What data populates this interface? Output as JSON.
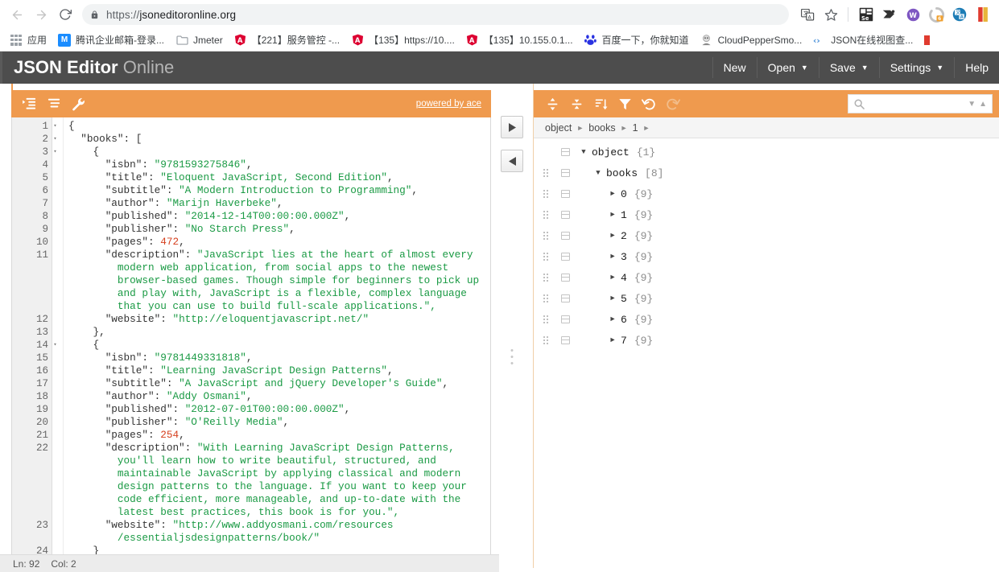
{
  "browser": {
    "back_icon": "back-arrow-icon",
    "forward_icon": "forward-arrow-icon",
    "reload_icon": "reload-icon",
    "lock_icon": "lock-icon",
    "url_scheme": "https://",
    "url_host": "jsoneditoronline.org",
    "url_full": "https://jsoneditoronline.org",
    "omnibar_icons": [
      {
        "name": "translate-icon",
        "glyph": "文A"
      },
      {
        "name": "bookmark-star-icon",
        "glyph": "☆"
      }
    ],
    "extension_icons": [
      {
        "name": "selenium-extension-icon",
        "glyph": "Se",
        "color": "#2b2b2b"
      },
      {
        "name": "wappalyzer-extension-icon",
        "glyph": "◥",
        "color": "#333333"
      },
      {
        "name": "vimium-extension-icon",
        "glyph": "W",
        "color": "#7e57c2"
      },
      {
        "name": "loading-extension-icon",
        "glyph": "◠",
        "color": "#b9b9b9",
        "badge": "6"
      },
      {
        "name": "translate-extension-icon",
        "glyph": "文",
        "color": "#1c7cb5"
      },
      {
        "name": "profile-avatar-icon",
        "glyph": "",
        "color": "#e03b2f"
      }
    ],
    "bookmarks": [
      {
        "name": "apps-grid",
        "label": "应用",
        "icon": "apps-grid-icon",
        "icon_glyph": "",
        "icon_color": "#9aa0a6"
      },
      {
        "name": "tencent-mail",
        "label": "腾讯企业邮箱-登录...",
        "icon": "tencent-mail-icon",
        "icon_glyph": "M",
        "icon_color": "#1a8cff"
      },
      {
        "name": "jmeter",
        "label": "Jmeter",
        "icon": "folder-icon",
        "icon_glyph": "",
        "icon_color": "#9aa0a6"
      },
      {
        "name": "service-control-221",
        "label": "【221】服务管控 -...",
        "icon": "angular-icon",
        "icon_glyph": "A",
        "icon_color": "#dd0031"
      },
      {
        "name": "https-10-135",
        "label": "【135】https://10....",
        "icon": "angular-icon",
        "icon_glyph": "A",
        "icon_color": "#dd0031"
      },
      {
        "name": "ip-10-155",
        "label": "【135】10.155.0.1...",
        "icon": "angular-icon",
        "icon_glyph": "A",
        "icon_color": "#dd0031"
      },
      {
        "name": "baidu",
        "label": "百度一下，你就知道",
        "icon": "baidu-icon",
        "icon_glyph": "熊",
        "icon_color": "#2932e1"
      },
      {
        "name": "cloudpepper",
        "label": "CloudPepperSmo...",
        "icon": "cloudpepper-icon",
        "icon_glyph": "☺",
        "icon_color": "#8a8a8a"
      },
      {
        "name": "json-viewer-cn",
        "label": "JSON在线视图查...",
        "icon": "code-brackets-icon",
        "icon_glyph": "‹›",
        "icon_color": "#4a90d9"
      }
    ]
  },
  "app": {
    "title_bold": "JSON Editor",
    "title_light": "Online",
    "accent_color": "#ef9a4e",
    "header_bg": "#4d4d4d",
    "menu": [
      {
        "name": "new",
        "label": "New",
        "caret": ""
      },
      {
        "name": "open",
        "label": "Open",
        "caret": "▼"
      },
      {
        "name": "save",
        "label": "Save",
        "caret": "▼"
      },
      {
        "name": "settings",
        "label": "Settings",
        "caret": "▼"
      },
      {
        "name": "help",
        "label": "Help",
        "caret": ""
      }
    ]
  },
  "left_pane": {
    "toolbar": {
      "buttons": [
        {
          "name": "format-button",
          "icon": "format-indent-icon"
        },
        {
          "name": "compact-button",
          "icon": "compact-lines-icon"
        },
        {
          "name": "repair-button",
          "icon": "wrench-icon"
        }
      ],
      "powered_by": "powered by ace"
    },
    "code_lines": [
      {
        "no": "1",
        "fold": "▾",
        "text": "{"
      },
      {
        "no": "2",
        "fold": "▾",
        "text": "  \"books\": ["
      },
      {
        "no": "3",
        "fold": "▾",
        "text": "    {"
      },
      {
        "no": "4",
        "fold": "",
        "text": "      \"isbn\": \"9781593275846\","
      },
      {
        "no": "5",
        "fold": "",
        "text": "      \"title\": \"Eloquent JavaScript, Second Edition\","
      },
      {
        "no": "6",
        "fold": "",
        "text": "      \"subtitle\": \"A Modern Introduction to Programming\","
      },
      {
        "no": "7",
        "fold": "",
        "text": "      \"author\": \"Marijn Haverbeke\","
      },
      {
        "no": "8",
        "fold": "",
        "text": "      \"published\": \"2014-12-14T00:00:00.000Z\","
      },
      {
        "no": "9",
        "fold": "",
        "text": "      \"publisher\": \"No Starch Press\","
      },
      {
        "no": "10",
        "fold": "",
        "text": "      \"pages\": 472,"
      },
      {
        "no": "11",
        "fold": "",
        "text": "      \"description\": \"JavaScript lies at the heart of almost every"
      },
      {
        "no": "",
        "fold": "",
        "text": "        modern web application, from social apps to the newest"
      },
      {
        "no": "",
        "fold": "",
        "text": "        browser-based games. Though simple for beginners to pick up"
      },
      {
        "no": "",
        "fold": "",
        "text": "        and play with, JavaScript is a flexible, complex language"
      },
      {
        "no": "",
        "fold": "",
        "text": "        that you can use to build full-scale applications.\","
      },
      {
        "no": "12",
        "fold": "",
        "text": "      \"website\": \"http://eloquentjavascript.net/\""
      },
      {
        "no": "13",
        "fold": "",
        "text": "    },"
      },
      {
        "no": "14",
        "fold": "▾",
        "text": "    {"
      },
      {
        "no": "15",
        "fold": "",
        "text": "      \"isbn\": \"9781449331818\","
      },
      {
        "no": "16",
        "fold": "",
        "text": "      \"title\": \"Learning JavaScript Design Patterns\","
      },
      {
        "no": "17",
        "fold": "",
        "text": "      \"subtitle\": \"A JavaScript and jQuery Developer's Guide\","
      },
      {
        "no": "18",
        "fold": "",
        "text": "      \"author\": \"Addy Osmani\","
      },
      {
        "no": "19",
        "fold": "",
        "text": "      \"published\": \"2012-07-01T00:00:00.000Z\","
      },
      {
        "no": "20",
        "fold": "",
        "text": "      \"publisher\": \"O'Reilly Media\","
      },
      {
        "no": "21",
        "fold": "",
        "text": "      \"pages\": 254,"
      },
      {
        "no": "22",
        "fold": "",
        "text": "      \"description\": \"With Learning JavaScript Design Patterns,"
      },
      {
        "no": "",
        "fold": "",
        "text": "        you'll learn how to write beautiful, structured, and"
      },
      {
        "no": "",
        "fold": "",
        "text": "        maintainable JavaScript by applying classical and modern"
      },
      {
        "no": "",
        "fold": "",
        "text": "        design patterns to the language. If you want to keep your"
      },
      {
        "no": "",
        "fold": "",
        "text": "        code efficient, more manageable, and up-to-date with the"
      },
      {
        "no": "",
        "fold": "",
        "text": "        latest best practices, this book is for you.\","
      },
      {
        "no": "23",
        "fold": "",
        "text": "      \"website\": \"http://www.addyosmani.com/resources"
      },
      {
        "no": "",
        "fold": "",
        "text": "        /essentialjsdesignpatterns/book/\""
      },
      {
        "no": "24",
        "fold": "",
        "text": "    }"
      }
    ]
  },
  "transfer": {
    "to_right": {
      "name": "transfer-right-button",
      "glyph": "▶"
    },
    "to_left": {
      "name": "transfer-left-button",
      "glyph": "◀"
    }
  },
  "right_pane": {
    "toolbar": {
      "buttons": [
        {
          "name": "expand-all-button",
          "icon": "expand-all-icon"
        },
        {
          "name": "collapse-all-button",
          "icon": "collapse-all-icon"
        },
        {
          "name": "sort-button",
          "icon": "sort-icon"
        },
        {
          "name": "filter-button",
          "icon": "filter-funnel-icon"
        },
        {
          "name": "undo-button",
          "icon": "undo-icon"
        },
        {
          "name": "redo-button",
          "icon": "redo-icon"
        }
      ],
      "search_placeholder": "",
      "search_value": "",
      "search_icon": "search-magnifier-icon",
      "next_result_icon": "chevron-down-icon",
      "prev_result_icon": "chevron-up-icon"
    },
    "breadcrumb": [
      "object",
      "books",
      "1"
    ],
    "tree": [
      {
        "label": "object",
        "count": "{1}",
        "expander": "▼",
        "indent": 0,
        "drag": false
      },
      {
        "label": "books",
        "count": "[8]",
        "expander": "▼",
        "indent": 1,
        "drag": true
      },
      {
        "label": "0",
        "count": "{9}",
        "expander": "►",
        "indent": 2,
        "drag": true
      },
      {
        "label": "1",
        "count": "{9}",
        "expander": "►",
        "indent": 2,
        "drag": true
      },
      {
        "label": "2",
        "count": "{9}",
        "expander": "►",
        "indent": 2,
        "drag": true
      },
      {
        "label": "3",
        "count": "{9}",
        "expander": "►",
        "indent": 2,
        "drag": true
      },
      {
        "label": "4",
        "count": "{9}",
        "expander": "►",
        "indent": 2,
        "drag": true
      },
      {
        "label": "5",
        "count": "{9}",
        "expander": "►",
        "indent": 2,
        "drag": true
      },
      {
        "label": "6",
        "count": "{9}",
        "expander": "►",
        "indent": 2,
        "drag": true
      },
      {
        "label": "7",
        "count": "{9}",
        "expander": "►",
        "indent": 2,
        "drag": true
      }
    ]
  },
  "statusbar": {
    "line_label": "Ln: 92",
    "col_label": "Col: 2"
  }
}
